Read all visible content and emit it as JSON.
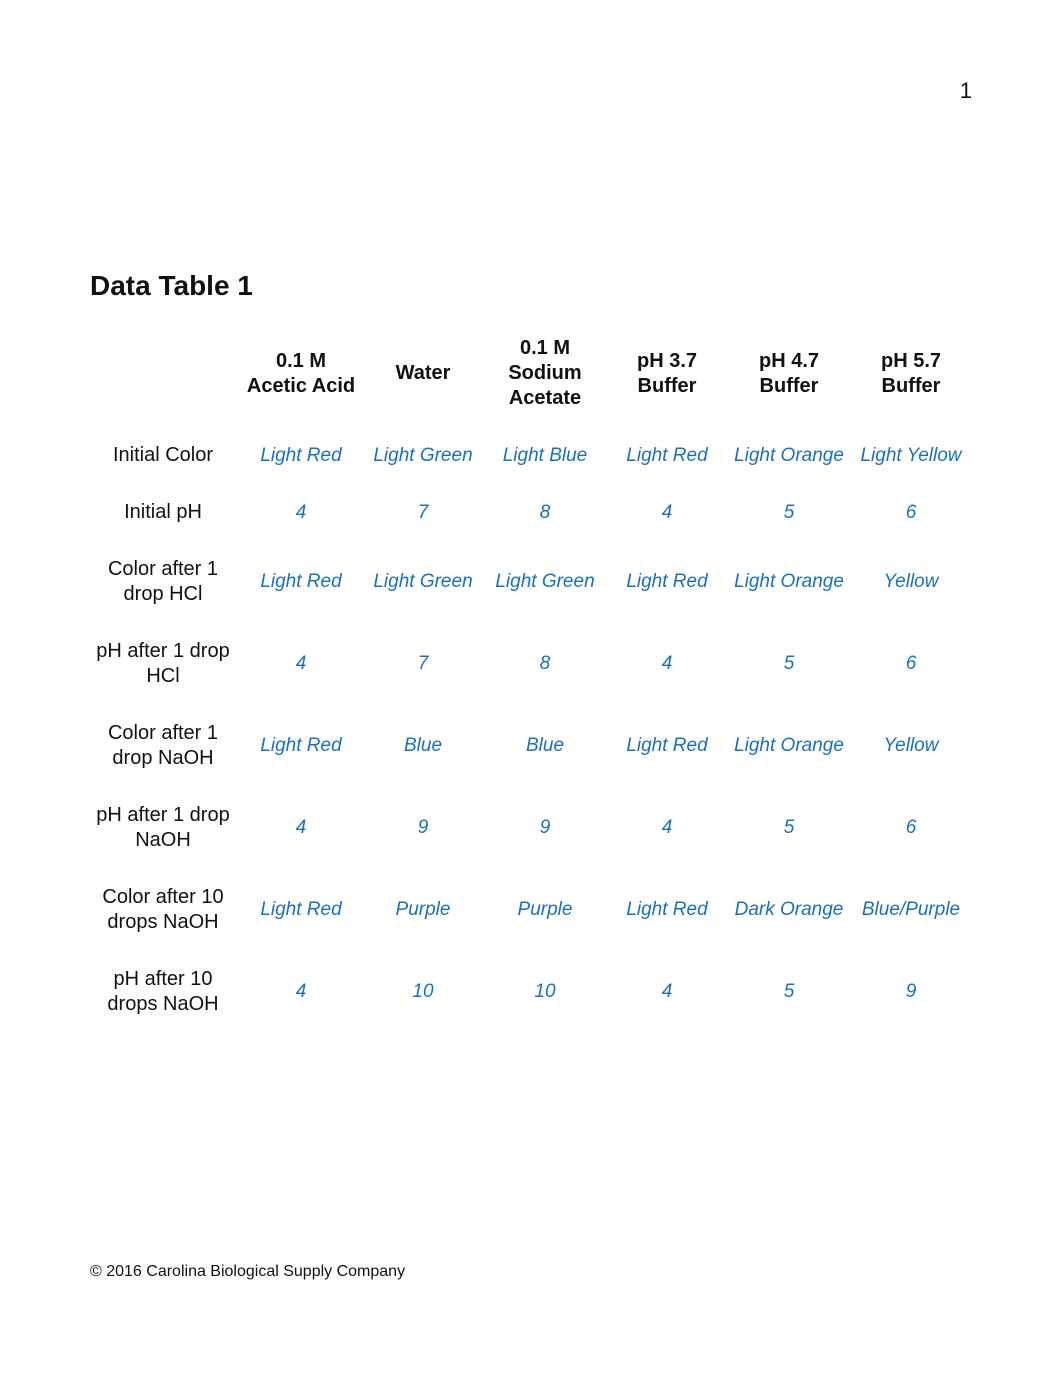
{
  "page_number": "1",
  "title": "Data Table 1",
  "footer": "© 2016 Carolina Biological Supply Company",
  "columns": [
    "0.1 M Acetic Acid",
    "Water",
    "0.1 M Sodium Acetate",
    "pH 3.7 Buffer",
    "pH 4.7 Buffer",
    "pH 5.7 Buffer"
  ],
  "rows": [
    {
      "label": "Initial Color",
      "values": [
        "Light Red",
        "Light Green",
        "Light Blue",
        "Light Red",
        "Light Orange",
        "Light Yellow"
      ]
    },
    {
      "label": "Initial pH",
      "values": [
        "4",
        "7",
        "8",
        "4",
        "5",
        "6"
      ]
    },
    {
      "label": "Color after 1 drop HCl",
      "values": [
        "Light Red",
        "Light Green",
        "Light Green",
        "Light Red",
        "Light Orange",
        "Yellow"
      ]
    },
    {
      "label": "pH after 1 drop HCl",
      "values": [
        "4",
        "7",
        "8",
        "4",
        "5",
        "6"
      ]
    },
    {
      "label": "Color after 1 drop NaOH",
      "values": [
        "Light Red",
        "Blue",
        "Blue",
        "Light Red",
        "Light Orange",
        "Yellow"
      ]
    },
    {
      "label": "pH after 1 drop NaOH",
      "values": [
        "4",
        "9",
        "9",
        "4",
        "5",
        "6"
      ]
    },
    {
      "label": "Color after 10 drops NaOH",
      "values": [
        "Light Red",
        "Purple",
        "Purple",
        "Light Red",
        "Dark Orange",
        "Blue/Purple"
      ]
    },
    {
      "label": "pH after 10 drops NaOH",
      "values": [
        "4",
        "10",
        "10",
        "4",
        "5",
        "9"
      ]
    }
  ]
}
